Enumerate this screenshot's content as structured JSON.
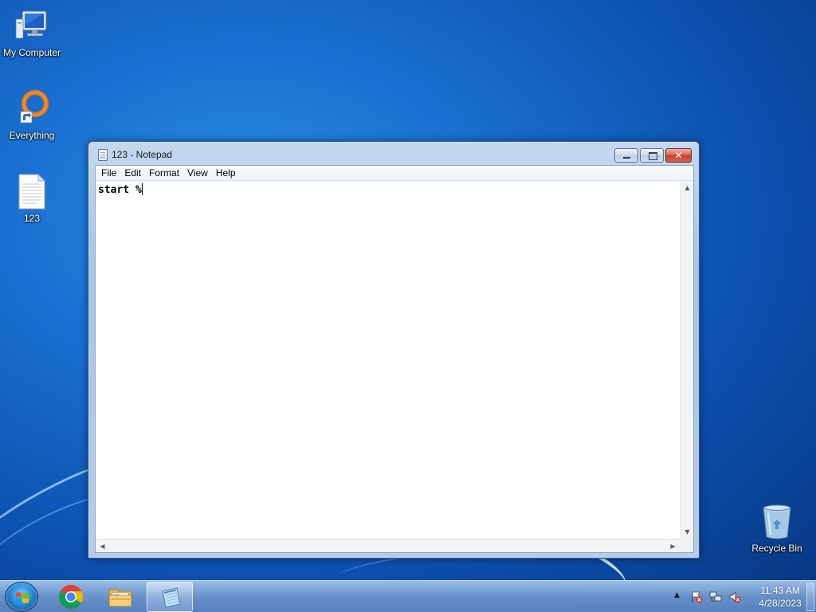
{
  "desktop": {
    "icons": [
      {
        "label": "My Computer",
        "icon": "computer-icon"
      },
      {
        "label": "Everything",
        "icon": "everything-search-icon"
      },
      {
        "label": "123",
        "icon": "text-file-icon"
      },
      {
        "label": "Recycle Bin",
        "icon": "recycle-bin-icon"
      }
    ]
  },
  "window": {
    "title": "123 - Notepad",
    "app_icon": "notepad-icon",
    "controls": {
      "minimize": "minimize-icon",
      "maximize": "maximize-icon",
      "close": "close-icon"
    },
    "menu": [
      {
        "label": "File"
      },
      {
        "label": "Edit"
      },
      {
        "label": "Format"
      },
      {
        "label": "View"
      },
      {
        "label": "Help"
      }
    ],
    "content": "start %"
  },
  "taskbar": {
    "start_icon": "windows-start-icon",
    "pinned": [
      {
        "name": "chrome",
        "icon": "chrome-icon"
      },
      {
        "name": "windows-explorer",
        "icon": "folder-icon"
      },
      {
        "name": "notepad",
        "icon": "notepad-icon",
        "active": true
      }
    ],
    "tray": {
      "icons": [
        "show-hidden-icons-arrow",
        "action-center-flag-icon",
        "network-icon",
        "volume-muted-icon"
      ],
      "time": "11:43 AM",
      "date": "4/28/2023"
    }
  },
  "colors": {
    "desktop_bg": "#1a6fd0",
    "close_button": "#c2402a",
    "window_frame": "#a9c4e6"
  }
}
